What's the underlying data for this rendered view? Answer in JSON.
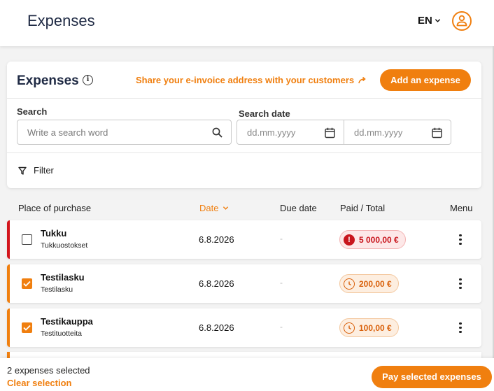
{
  "header": {
    "title": "Expenses",
    "language": "EN"
  },
  "panel": {
    "title": "Expenses",
    "share_link": "Share your e-invoice address with your customers",
    "add_button": "Add an expense",
    "search_label": "Search",
    "search_placeholder": "Write a search word",
    "date_label": "Search date",
    "date_from_placeholder": "dd.mm.yyyy",
    "date_to_placeholder": "dd.mm.yyyy",
    "filter_label": "Filter"
  },
  "table": {
    "columns": {
      "place": "Place of purchase",
      "date": "Date",
      "due": "Due date",
      "paid": "Paid / Total",
      "menu": "Menu"
    },
    "rows": [
      {
        "name": "Tukku",
        "subtitle": "Tukkuostokset",
        "date": "6.8.2026",
        "due": "-",
        "amount": "5 000,00 €",
        "status": "overdue",
        "selected": false
      },
      {
        "name": "Testilasku",
        "subtitle": "Testilasku",
        "date": "6.8.2026",
        "due": "-",
        "amount": "200,00 €",
        "status": "pending",
        "selected": true
      },
      {
        "name": "Testikauppa",
        "subtitle": "Testituotteita",
        "date": "6.8.2026",
        "due": "-",
        "amount": "100,00 €",
        "status": "pending",
        "selected": true
      }
    ]
  },
  "footer": {
    "selected_count": "2 expenses selected",
    "clear_selection": "Clear selection",
    "pay_button": "Pay selected expenses"
  },
  "colors": {
    "accent": "#f07f0f",
    "overdue": "#c8161d",
    "pending": "#d9610c"
  },
  "icons": [
    "chevron-down-icon",
    "user-icon",
    "info-icon",
    "arrow-share-icon",
    "search-icon",
    "calendar-icon",
    "filter-icon",
    "checkbox-icon",
    "alert-icon",
    "clock-icon",
    "kebab-menu-icon"
  ]
}
